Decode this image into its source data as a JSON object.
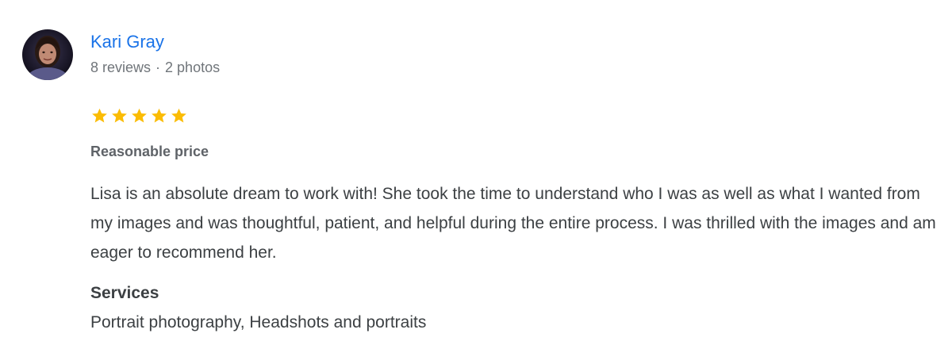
{
  "review": {
    "reviewer": {
      "name": "Kari Gray",
      "reviews_count": "8 reviews",
      "separator": "·",
      "photos_count": "2 photos",
      "avatar": "reviewer-photo"
    },
    "rating": {
      "value": 5,
      "max": 5,
      "star_color": "#fbbc04"
    },
    "subtitle": "Reasonable price",
    "text": "Lisa is an absolute dream to work with! She took the time to understand who I was as well as what I wanted from my images and was thoughtful, patient, and helpful during the entire process. I was thrilled with the images and am eager to recommend her.",
    "services": {
      "heading": "Services",
      "value": "Portrait photography, Headshots and portraits"
    }
  },
  "colors": {
    "name_link": "#1a73e8",
    "meta_text": "#70757a",
    "body_text": "#3c4043"
  }
}
